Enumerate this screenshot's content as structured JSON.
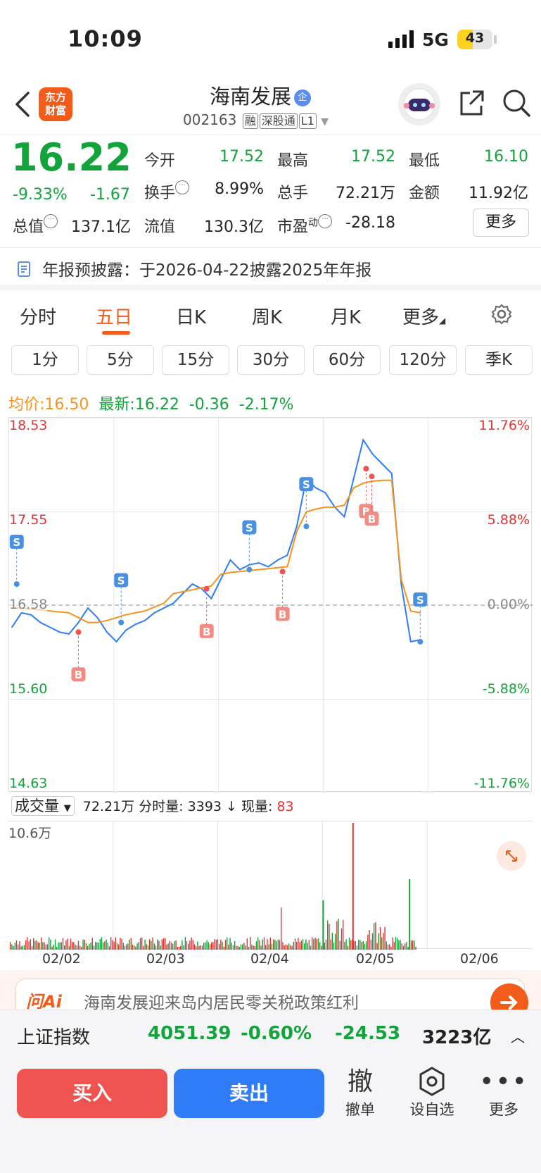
{
  "status": {
    "time": "10:09",
    "network": "5G",
    "battery": "43",
    "battery_level": 0.43
  },
  "header": {
    "logo_line1": "东方",
    "logo_line2": "财富",
    "title": "海南发展",
    "title_badge": "企",
    "code": "002163",
    "tags": [
      "融",
      "深股通",
      "L1"
    ]
  },
  "quote": {
    "price": "16.22",
    "change_pct": "-9.33%",
    "change_amt": "-1.67",
    "open_label": "今开",
    "open": "17.52",
    "high_label": "最高",
    "high": "17.52",
    "low_label": "最低",
    "low": "16.10",
    "turnover_label": "换手",
    "turnover": "8.99%",
    "volume_label": "总手",
    "volume": "72.21万",
    "amount_label": "金额",
    "amount": "11.92亿",
    "mktcap_label": "总值",
    "mktcap": "137.1亿",
    "float_label": "流值",
    "float": "130.3亿",
    "pe_label": "市盈",
    "pe_sup": "动",
    "pe": "-28.18",
    "more": "更多"
  },
  "notice": {
    "text": "年报预披露：于2026-04-22披露2025年年报"
  },
  "tabs": [
    "分时",
    "五日",
    "日K",
    "周K",
    "月K",
    "更多"
  ],
  "periods": [
    "1分",
    "5分",
    "15分",
    "30分",
    "60分",
    "120分",
    "季K"
  ],
  "avg": {
    "avg_label": "均价:",
    "avg": "16.50",
    "latest_label": "最新:",
    "latest": "16.22",
    "chg": "-0.36",
    "pct": "-2.17%"
  },
  "chart_data": {
    "type": "line",
    "title": "",
    "y_left_ticks": [
      "18.53",
      "17.55",
      "16.58",
      "15.60",
      "14.63"
    ],
    "y_right_ticks": [
      "11.76%",
      "5.88%",
      "0.00%",
      "-5.88%",
      "-11.76%"
    ],
    "ylim": [
      14.63,
      18.53
    ],
    "ref_price": 16.58,
    "x_dates": [
      "02/02",
      "02/03",
      "02/04",
      "02/05",
      "02/06"
    ],
    "series": [
      {
        "name": "",
        "color": "#2f7cf6",
        "values": [
          16.35,
          16.5,
          16.48,
          16.4,
          16.35,
          16.3,
          16.28,
          16.4,
          16.55,
          16.45,
          16.3,
          16.2,
          16.32,
          16.38,
          16.42,
          16.5,
          16.55,
          16.6,
          16.7,
          16.8,
          16.75,
          16.65,
          16.85,
          17.05,
          16.95,
          17.0,
          17.02,
          16.98,
          17.05,
          17.1,
          17.4,
          17.9,
          17.8,
          17.75,
          17.6,
          17.5,
          17.9,
          18.3,
          18.15,
          18.05,
          17.95,
          16.8,
          16.2,
          16.22
        ]
      },
      {
        "name": "",
        "color": "#f5931e",
        "values": [
          16.55,
          16.55,
          16.54,
          16.53,
          16.52,
          16.51,
          16.5,
          16.45,
          16.4,
          16.4,
          16.42,
          16.45,
          16.48,
          16.5,
          16.52,
          16.56,
          16.6,
          16.7,
          16.72,
          16.74,
          16.76,
          16.78,
          16.9,
          16.92,
          16.93,
          16.94,
          16.95,
          16.96,
          16.97,
          16.98,
          17.35,
          17.55,
          17.58,
          17.6,
          17.6,
          17.62,
          17.8,
          17.85,
          17.87,
          17.88,
          17.88,
          16.85,
          16.52,
          16.5
        ]
      }
    ],
    "markers": [
      {
        "type": "S",
        "x": 0.5,
        "price": 16.8
      },
      {
        "type": "B",
        "x": 7,
        "price": 16.3
      },
      {
        "type": "S",
        "x": 11.5,
        "price": 16.4
      },
      {
        "type": "B",
        "x": 20.5,
        "price": 16.75
      },
      {
        "type": "S",
        "x": 25,
        "price": 16.95
      },
      {
        "type": "B",
        "x": 28.5,
        "price": 16.93
      },
      {
        "type": "S",
        "x": 31,
        "price": 17.4
      },
      {
        "type": "B",
        "x": 37.3,
        "price": 18.0
      },
      {
        "type": "B",
        "x": 37.9,
        "price": 17.92
      },
      {
        "type": "S",
        "x": 43,
        "price": 16.2
      }
    ]
  },
  "volume": {
    "selector": "成交量",
    "total": "72.21万",
    "per_label": "分时量:",
    "per": "3393",
    "arrow": "↓",
    "now_label": "现量:",
    "now": "83",
    "max": "10.6万"
  },
  "ai": {
    "logo": "问Ai",
    "text": "海南发展迎来岛内居民零关税政策红利"
  },
  "index": {
    "name": "上证指数",
    "value": "4051.39",
    "pct": "-0.60%",
    "chg": "-24.53",
    "amount": "3223亿"
  },
  "bottom": {
    "buy": "买入",
    "sell": "卖出",
    "cancel_icon": "撤",
    "cancel": "撤单",
    "watch": "设自选",
    "more": "更多"
  },
  "colors": {
    "brand": "#f25b1a",
    "down": "#12a33b",
    "up": "#e63232",
    "price_line": "#2f7cf6",
    "avg_line": "#f5931e"
  }
}
